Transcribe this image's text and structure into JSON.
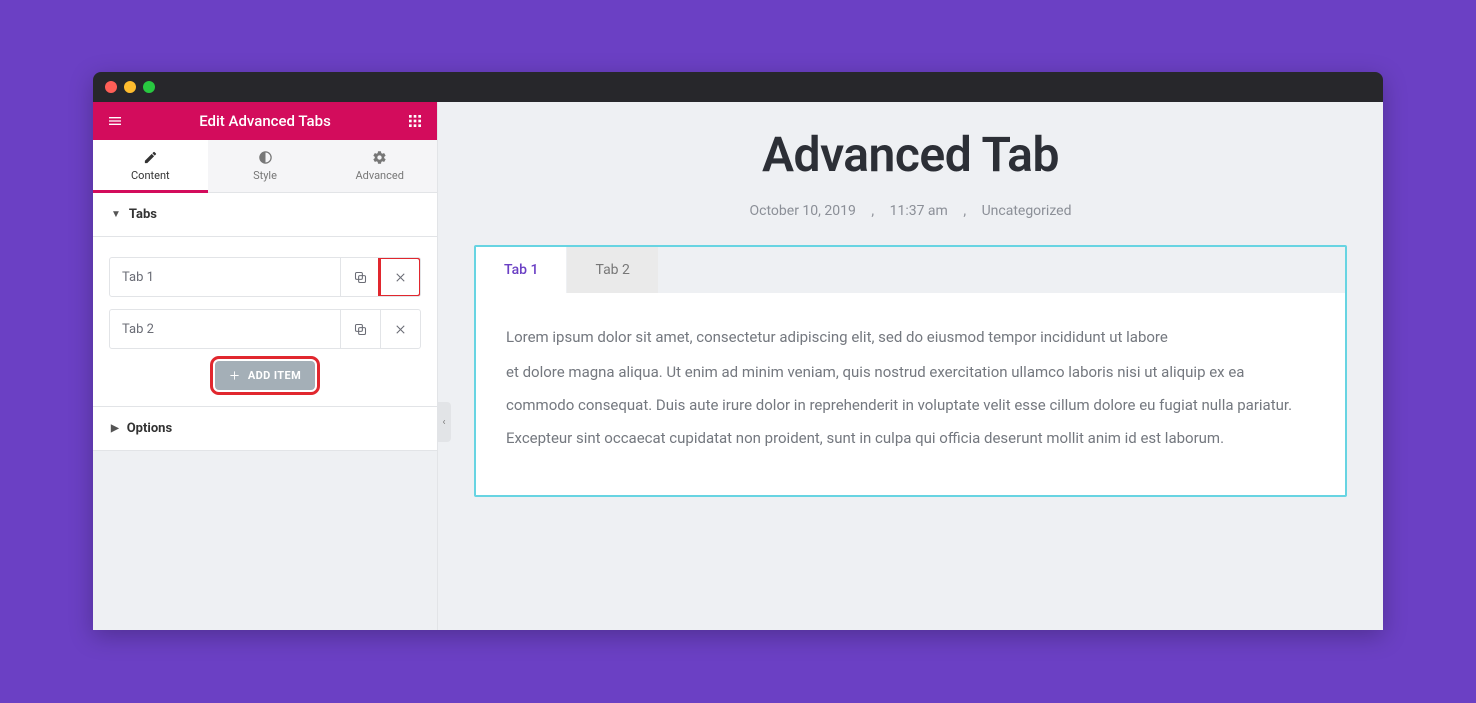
{
  "header": {
    "title": "Edit Advanced Tabs"
  },
  "sidebar_tabs": {
    "content": "Content",
    "style": "Style",
    "advanced": "Advanced"
  },
  "sections": {
    "tabs": "Tabs",
    "options": "Options"
  },
  "items": [
    {
      "label": "Tab 1"
    },
    {
      "label": "Tab 2"
    }
  ],
  "add_item_label": "ADD ITEM",
  "preview": {
    "title": "Advanced Tab",
    "date": "October 10, 2019",
    "time": "11:37 am",
    "category": "Uncategorized",
    "tabs": [
      {
        "label": "Tab 1"
      },
      {
        "label": "Tab 2"
      }
    ],
    "body_line1": "Lorem ipsum dolor sit amet, consectetur adipiscing elit, sed do eiusmod tempor incididunt ut labore",
    "body_line2": "et dolore magna aliqua. Ut enim ad minim veniam, quis nostrud exercitation ullamco laboris nisi ut aliquip ex ea commodo consequat. Duis aute irure dolor in reprehenderit in voluptate velit esse cillum dolore eu fugiat nulla pariatur. Excepteur sint occaecat cupidatat non proident, sunt in culpa qui officia deserunt mollit anim id est laborum."
  }
}
